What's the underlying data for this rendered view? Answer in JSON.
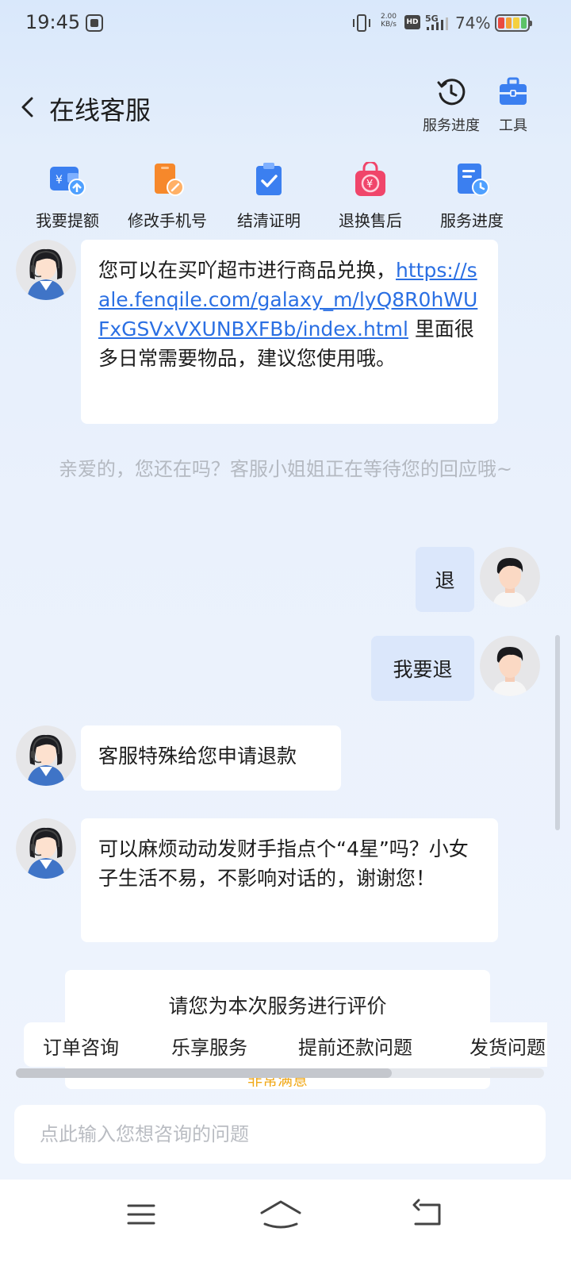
{
  "status_bar": {
    "time": "19:45",
    "net_speed_value": "2.00",
    "net_speed_unit": "KB/s",
    "hd": "HD",
    "network": "5G",
    "battery": "74%"
  },
  "header": {
    "title": "在线客服",
    "progress_label": "服务进度",
    "tools_label": "工具"
  },
  "quick_menu": [
    {
      "label": "我要提额",
      "icon": "wallet-up-icon",
      "color": "#3b7ff0"
    },
    {
      "label": "修改手机号",
      "icon": "phone-edit-icon",
      "color": "#f6882b"
    },
    {
      "label": "结清证明",
      "icon": "clipboard-check-icon",
      "color": "#3b7ff0"
    },
    {
      "label": "退换售后",
      "icon": "shopping-bag-yuan-icon",
      "color": "#f0456a"
    },
    {
      "label": "服务进度",
      "icon": "document-clock-icon",
      "color": "#3b7ff0"
    }
  ],
  "messages": {
    "m1_text_before": "您可以在买吖超市进行商品兑换，",
    "m1_link": "https://sale.fenqile.com/galaxy_m/lyQ8R0hWUFxGSVxVXUNBXFBb/index.html",
    "m1_text_after": " 里面很多日常需要物品，建议您使用哦。",
    "system": "亲爱的，您还在吗？客服小姐姐正在等待您的回应哦~",
    "user1": "退",
    "user2": "我要退",
    "m2": "客服特殊给您申请退款",
    "m3": "可以麻烦动动发财手指点个“4星”吗？小女子生活不易，不影响对话的，谢谢您！"
  },
  "rating": {
    "title": "请您为本次服务进行评价",
    "option": "非常满意"
  },
  "quick_chips": [
    "订单咨询",
    "乐享服务",
    "提前还款问题",
    "发货问题"
  ],
  "input": {
    "placeholder": "点此输入您想咨询的问题"
  },
  "colors": {
    "accent": "#3b7ff0",
    "link": "#2a6fe3",
    "user_bubble": "#dbe7fb",
    "rating": "#f1a817"
  }
}
